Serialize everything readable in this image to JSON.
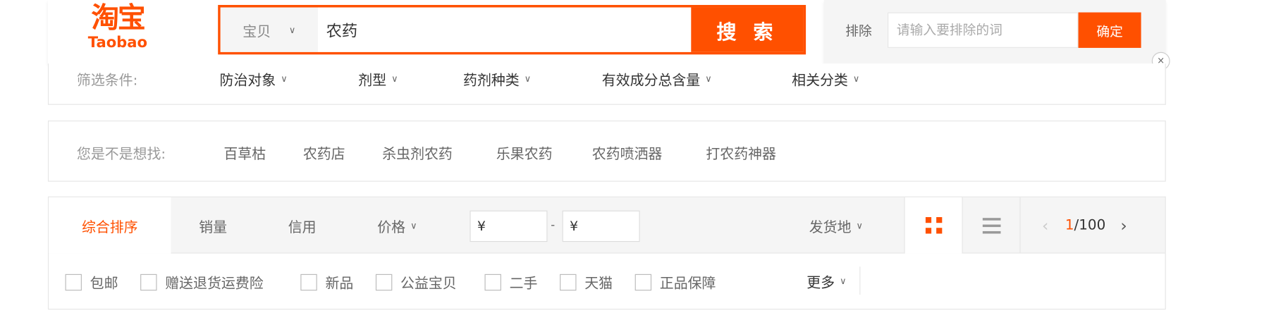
{
  "header": {
    "logo_cn": "淘宝",
    "logo_en": "Taobao",
    "scope": "宝贝",
    "query": "农药",
    "search_label": "搜 索",
    "exclude_label": "排除",
    "exclude_placeholder": "请输入要排除的词",
    "exclude_button": "确定",
    "close": "×"
  },
  "filters": {
    "label": "筛选条件:",
    "items": [
      "防治对象",
      "剂型",
      "药剂种类",
      "有效成分总含量",
      "相关分类"
    ]
  },
  "suggest": {
    "label": "您是不是想找:",
    "items": [
      "百草枯",
      "农药店",
      "杀虫剂农药",
      "乐果农药",
      "农药喷洒器",
      "打农药神器"
    ]
  },
  "sort": {
    "tabs": [
      "综合排序",
      "销量",
      "信用",
      "价格"
    ],
    "price_from": "¥",
    "price_to": "¥",
    "dash": "-",
    "location": "发货地",
    "page_current": "1",
    "page_total": "/100",
    "active_color": "#ff5000"
  },
  "options": {
    "checkboxes": [
      "包邮",
      "赠送退货运费险",
      "新品",
      "公益宝贝",
      "二手",
      "天猫",
      "正品保障"
    ],
    "more": "更多"
  }
}
